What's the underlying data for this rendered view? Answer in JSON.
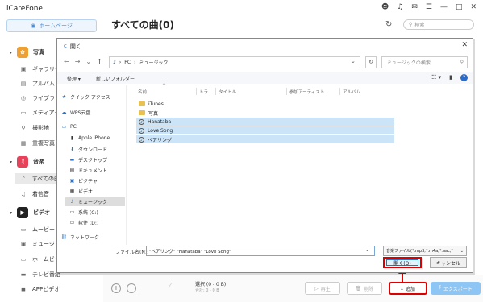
{
  "app": {
    "title": "iCareFone",
    "home_button": "ホームページ",
    "page_title": "すべての曲(0)",
    "search_placeholder": "検索"
  },
  "sidebar": {
    "photos_category": "写真",
    "photo_items": [
      "ギャラリー",
      "アルバム",
      "ライブラリ",
      "メディアタ",
      "撮影地",
      "重複写真"
    ],
    "music_category": "音楽",
    "music_items": [
      "すべての曲",
      "着信音"
    ],
    "video_category": "ビデオ",
    "video_items": [
      "ムービー",
      "ミュージッ",
      "ホームビデ",
      "テレビ番組",
      "APPビデオ"
    ]
  },
  "bottom_bar": {
    "selection": "選択 (0 - 0 B)",
    "total": "合計: 0 - 0 B",
    "play_label": "再生",
    "delete_label": "削除",
    "add_label": "追加",
    "export_label": "エクスポート"
  },
  "dialog": {
    "title": "開く",
    "path": [
      "PC",
      "ミュージック"
    ],
    "search_placeholder": "ミュージックの検索",
    "organize_label": "整理 ▾",
    "new_folder_label": "新しいフォルダー",
    "nav_items": [
      "クイック アクセス",
      "WPS云盘",
      "PC",
      "Apple iPhone",
      "ダウンロード",
      "デスクトップ",
      "ドキュメント",
      "ピクチャ",
      "ビデオ",
      "ミュージック",
      "系统 (C:)",
      "软件 (D:)",
      "ネットワーク"
    ],
    "columns": [
      "名前",
      "トラ...",
      "タイトル",
      "参加アーティスト",
      "アルバム"
    ],
    "files": [
      {
        "name": "iTunes",
        "type": "folder",
        "selected": false
      },
      {
        "name": "写真",
        "type": "folder",
        "selected": false
      },
      {
        "name": "Hanataba",
        "type": "music",
        "selected": true
      },
      {
        "name": "Love Song",
        "type": "music",
        "selected": true
      },
      {
        "name": "ベアリング",
        "type": "music",
        "selected": true
      }
    ],
    "filename_label": "ファイル名(N):",
    "filename_value": "\"ベアリング\" \"Hanataba\" \"Love Song\"",
    "filetype_value": "音楽ファイル(*.mp3;*.m4a;*.aac;*",
    "open_label": "開く(O)",
    "cancel_label": "キャンセル"
  }
}
